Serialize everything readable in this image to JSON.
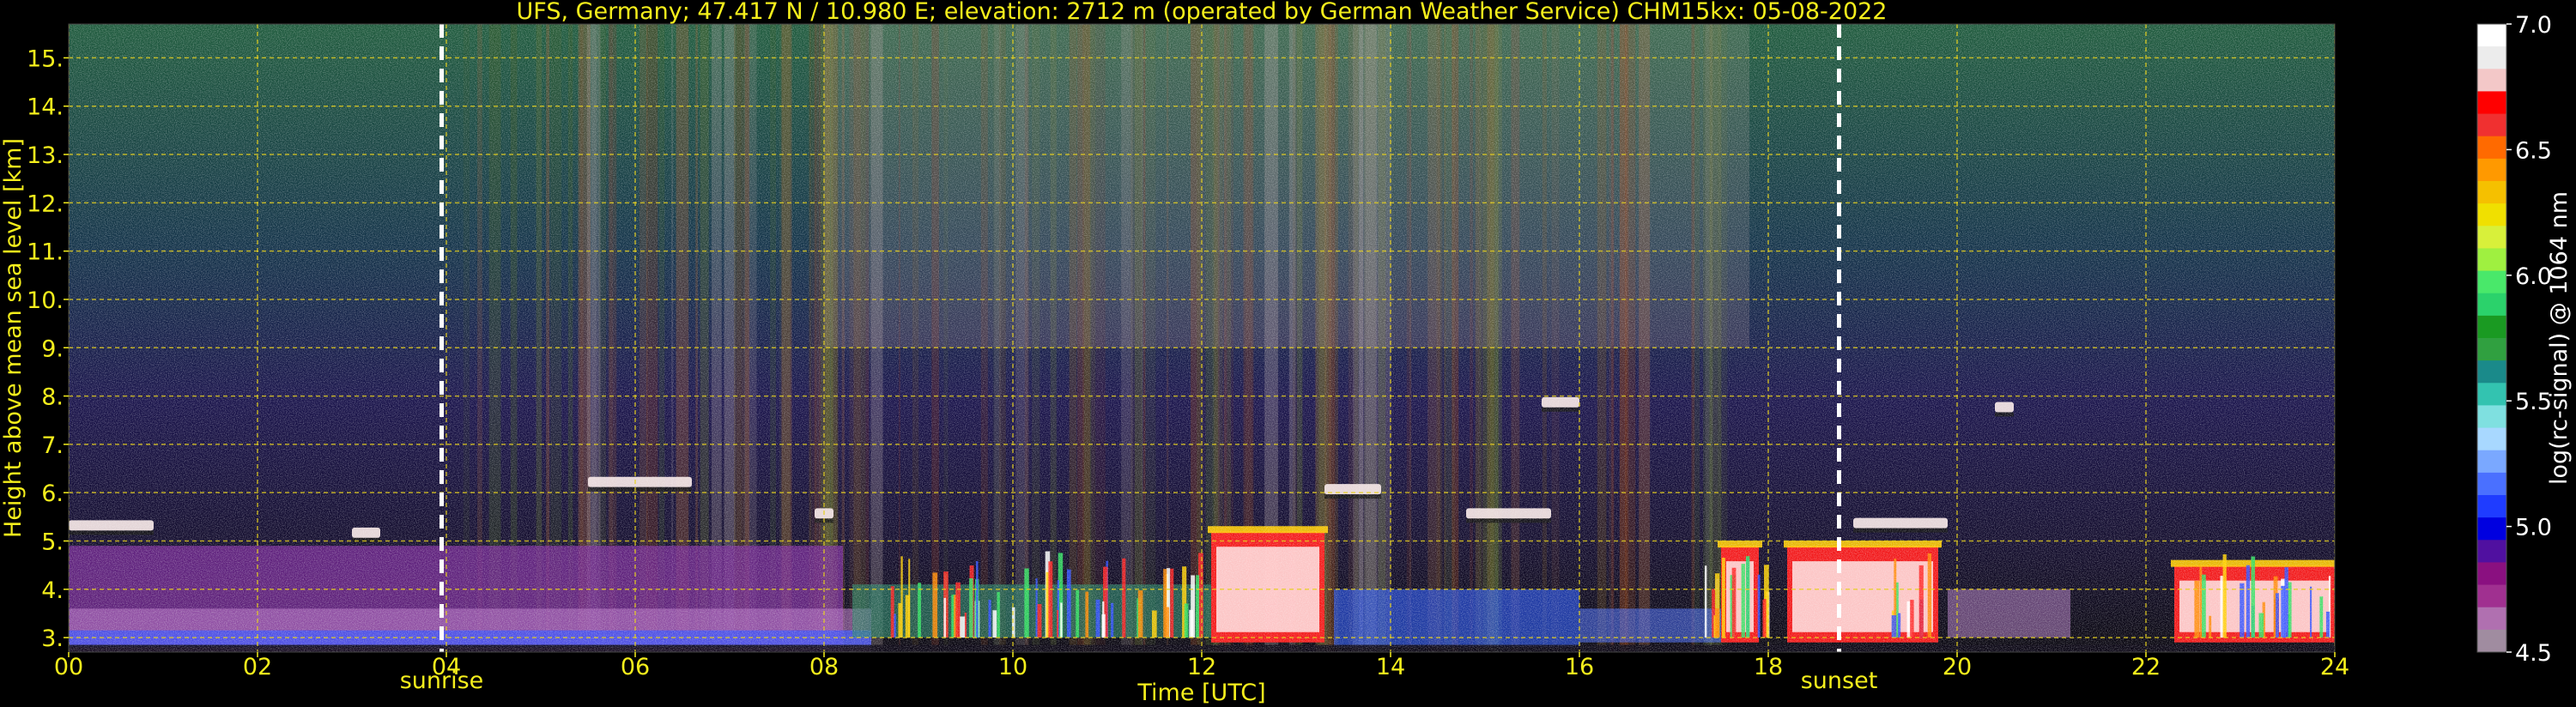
{
  "chart_data": {
    "type": "heatmap",
    "title": "UFS, Germany; 47.417 N / 10.980 E; elevation: 2712 m  (operated by German Weather Service)    CHM15kx: 05-08-2022",
    "xlabel": "Time [UTC]",
    "ylabel": "Height above mean sea level [km]",
    "xlim": [
      0,
      24
    ],
    "ylim": [
      2.7,
      15.7
    ],
    "x_ticks": [
      "00",
      "02",
      "04",
      "06",
      "08",
      "10",
      "12",
      "14",
      "16",
      "18",
      "20",
      "22",
      "24"
    ],
    "y_ticks": [
      "3.",
      "4.",
      "5.",
      "6.",
      "7.",
      "8.",
      "9.",
      "10.",
      "11.",
      "12.",
      "13.",
      "14.",
      "15."
    ],
    "grid": true,
    "annotations": [
      {
        "text": "sunrise",
        "x": 3.95
      },
      {
        "text": "sunset",
        "x": 18.75
      }
    ],
    "colorbar": {
      "label": "log(rc-signal) @ 1064 nm",
      "min": 4.5,
      "max": 7.0,
      "ticks": [
        "7.0",
        "6.5",
        "6.0",
        "5.5",
        "5.0",
        "4.5"
      ],
      "colors": [
        "#ffffff",
        "#ececec",
        "#f3c8c8",
        "#ff0000",
        "#f03030",
        "#ff6a00",
        "#ff9900",
        "#f5c000",
        "#f0e000",
        "#d8f03a",
        "#9ff040",
        "#49e86a",
        "#2bd26b",
        "#1a9a22",
        "#30a040",
        "#1a8a8a",
        "#33c3b0",
        "#7fe0e0",
        "#a8d8ff",
        "#7aa8ff",
        "#4a70ff",
        "#1f3cff",
        "#0000e0",
        "#5010a0",
        "#8a1080",
        "#a03090",
        "#b070b0",
        "#a08ca0"
      ]
    },
    "features": {
      "cloud_layers": [
        {
          "start": 0.0,
          "end": 0.9,
          "base_km": 5.25
        },
        {
          "start": 3.0,
          "end": 3.3,
          "base_km": 5.1
        },
        {
          "start": 5.5,
          "end": 6.6,
          "base_km": 6.15
        },
        {
          "start": 7.9,
          "end": 8.1,
          "base_km": 5.5
        },
        {
          "start": 13.3,
          "end": 13.9,
          "base_km": 6.0
        },
        {
          "start": 14.8,
          "end": 15.7,
          "base_km": 5.5
        },
        {
          "start": 15.6,
          "end": 16.0,
          "base_km": 7.8
        },
        {
          "start": 18.9,
          "end": 19.9,
          "base_km": 5.3
        },
        {
          "start": 20.4,
          "end": 20.6,
          "base_km": 7.7
        }
      ],
      "low_strong_returns": [
        {
          "start": 12.1,
          "end": 13.3,
          "top_km": 5.2
        },
        {
          "start": 17.5,
          "end": 17.9,
          "top_km": 4.9
        },
        {
          "start": 18.2,
          "end": 19.8,
          "top_km": 4.9
        },
        {
          "start": 22.3,
          "end": 24.0,
          "top_km": 4.5
        }
      ]
    }
  }
}
